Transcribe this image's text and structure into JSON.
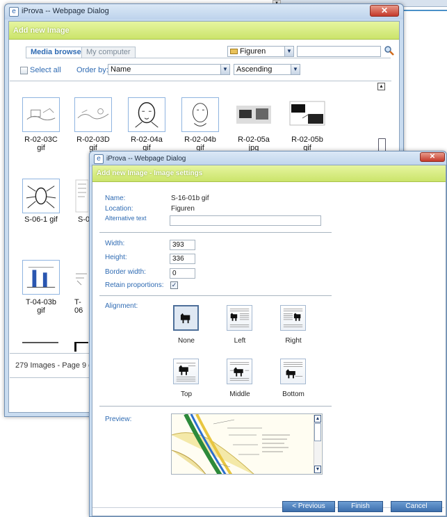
{
  "background": {
    "scroll_glyph": "▾"
  },
  "media_dialog": {
    "title": "iProva -- Webpage Dialog",
    "close_glyph": "✕",
    "header": "Add new Image",
    "tabs": [
      {
        "label": "Media browser",
        "active": true
      },
      {
        "label": "My computer",
        "active": false
      }
    ],
    "folder_select": {
      "value": "Figuren"
    },
    "select_all_label": "Select all",
    "order_by_label": "Order by:",
    "order_by_value": "Name",
    "direction_value": "Ascending",
    "thumbnails_row1": [
      {
        "caption": "R-02-03C\ngif",
        "icon": "line-drawing"
      },
      {
        "caption": "R-02-03D\ngif",
        "icon": "line-drawing"
      },
      {
        "caption": "R-02-04a\ngif",
        "icon": "face-drawing"
      },
      {
        "caption": "R-02-04b\ngif",
        "icon": "face-drawing"
      },
      {
        "caption": "R-02-05a\njpg",
        "icon": "photo"
      },
      {
        "caption": "R-02-05b\ngif",
        "icon": "photo"
      }
    ],
    "thumbnails_row2": [
      {
        "caption": "S-06-1 gif",
        "icon": "insect-drawing"
      },
      {
        "caption": "S-0",
        "icon": "text-page"
      }
    ],
    "thumbnails_row3": [
      {
        "caption": "T-04-03b\ngif",
        "icon": "diagram"
      },
      {
        "caption": "T-06",
        "icon": "sketch"
      }
    ],
    "status_text": "279 Images - Page 9 o",
    "scroll_up_glyph": "▲"
  },
  "settings_dialog": {
    "title": "iProva -- Webpage Dialog",
    "close_glyph": "✕",
    "header": "Add new Image - Image settings",
    "name_label": "Name:",
    "name_value": "S-16-01b gif",
    "location_label": "Location:",
    "location_value": "Figuren",
    "alt_label": "Alternative text",
    "alt_value": "",
    "width_label": "Width:",
    "width_value": "393",
    "height_label": "Height:",
    "height_value": "336",
    "border_label": "Border width:",
    "border_value": "0",
    "retain_label": "Retain proportions:",
    "retain_checked": true,
    "alignment_label": "Alignment:",
    "alignments": [
      {
        "label": "None",
        "selected": true
      },
      {
        "label": "Left",
        "selected": false
      },
      {
        "label": "Right",
        "selected": false
      },
      {
        "label": "Top",
        "selected": false
      },
      {
        "label": "Middle",
        "selected": false
      },
      {
        "label": "Bottom",
        "selected": false
      }
    ],
    "preview_label": "Preview:",
    "buttons": {
      "previous": "< Previous",
      "finish": "Finish",
      "cancel": "Cancel"
    }
  },
  "colors": {
    "header_green": "#cbe46b",
    "link_blue": "#2f6bb3",
    "button_blue": "#3d6fad"
  }
}
